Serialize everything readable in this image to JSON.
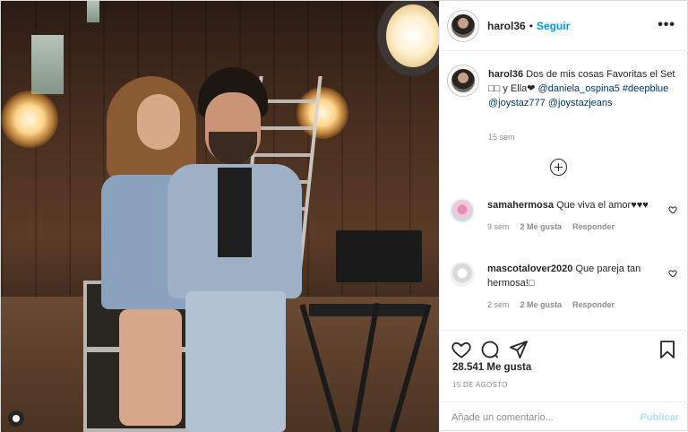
{
  "post": {
    "author": "harol36",
    "separator": "•",
    "follow_label": "Seguir",
    "more_label": "•••",
    "caption": {
      "username": "harol36",
      "text_start": "Dos de mis cosas Favoritas el Set ",
      "emoji_placeholder": "□□",
      "text_mid": " y Ella❤ ",
      "mention_1": "@daniela_ospina5",
      "hashtag": "#deepblue",
      "mention_2": "@joystaz777",
      "mention_3": "@joystazjeans",
      "time": "15 sem"
    },
    "comments": [
      {
        "username": "samahermosa",
        "text": "Que viva el amor♥♥♥",
        "time": "9 sem",
        "likes": "2 Me gusta",
        "reply_label": "Responder"
      },
      {
        "username": "mascotalover2020",
        "text": "Que pareja tan hermosa!□",
        "time": "2 sem",
        "likes": "2 Me gusta",
        "reply_label": "Responder"
      }
    ],
    "likes_text": "28.541 Me gusta",
    "date_text": "15 DE AGOSTO",
    "comment_placeholder": "Añade un comentario...",
    "publish_label": "Publicar"
  },
  "icons": [
    "heart-icon",
    "comment-icon",
    "share-icon",
    "bookmark-icon",
    "plus-circle-icon",
    "more-icon"
  ],
  "colors": {
    "link": "#00376b",
    "follow": "#0095f6",
    "publish_disabled": "#b2dffc",
    "muted": "#8e8e8e"
  }
}
